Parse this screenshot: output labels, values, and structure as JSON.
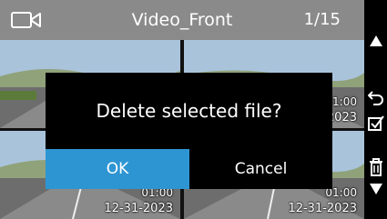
{
  "header": {
    "camera_icon": "camera-icon",
    "title": "Video_Front",
    "counter": "1/15"
  },
  "thumbnails": [
    {
      "time": "",
      "date": "",
      "selected": true
    },
    {
      "time": "01:00",
      "date": "12-31-2023",
      "selected": false
    },
    {
      "time": "01:00",
      "date": "12-31-2023",
      "selected": false
    },
    {
      "time": "01:00",
      "date": "12-31-2023",
      "selected": false
    }
  ],
  "dialog": {
    "message": "Delete selected file?",
    "ok_label": "OK",
    "cancel_label": "Cancel"
  },
  "sidebar": {
    "icons": [
      "up-arrow-icon",
      "back-icon",
      "select-icon",
      "delete-icon",
      "down-arrow-icon"
    ]
  },
  "colors": {
    "header_bg": "#8a8a8a",
    "accent": "#2e95d3",
    "dialog_bg": "#000000"
  }
}
